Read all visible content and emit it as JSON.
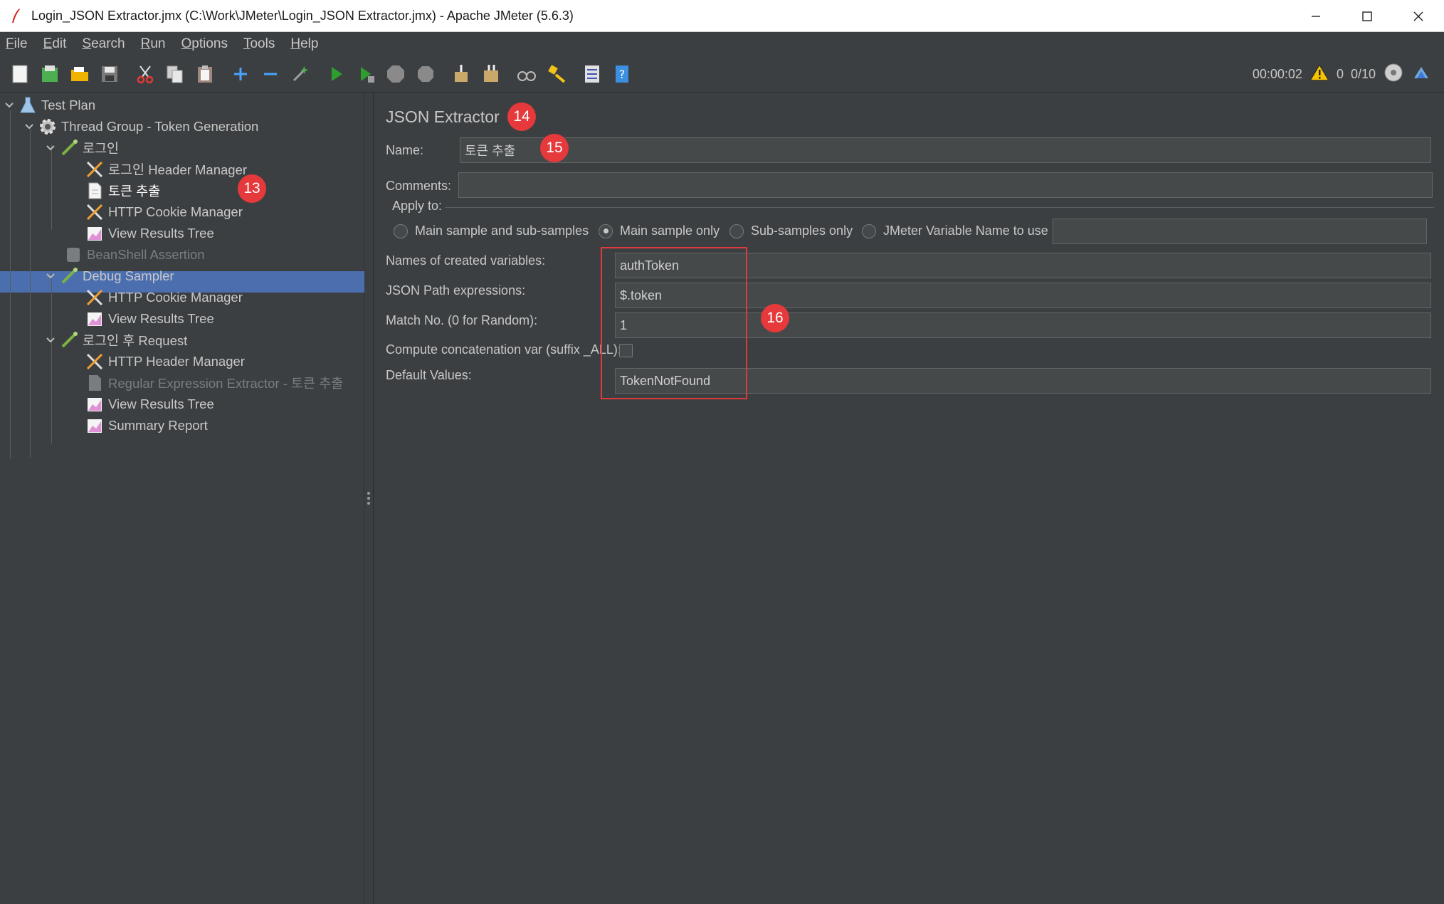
{
  "window": {
    "title": "Login_JSON Extractor.jmx (C:\\Work\\JMeter\\Login_JSON Extractor.jmx) - Apache JMeter (5.6.3)"
  },
  "menu": [
    {
      "mn": "F",
      "rest": "ile"
    },
    {
      "mn": "E",
      "rest": "dit"
    },
    {
      "mn": "S",
      "rest": "earch"
    },
    {
      "mn": "R",
      "rest": "un"
    },
    {
      "mn": "O",
      "rest": "ptions"
    },
    {
      "mn": "T",
      "rest": "ools"
    },
    {
      "mn": "H",
      "rest": "elp"
    }
  ],
  "status": {
    "elapsed": "00:00:02",
    "warnings": "0",
    "threads": "0/10"
  },
  "tree": {
    "test_plan": "Test Plan",
    "thread_group": "Thread Group - Token Generation",
    "login": "로그인",
    "login_header_manager": "로그인 Header Manager",
    "token_extract": "토큰 추출",
    "cookie_manager_1": "HTTP Cookie Manager",
    "results_tree_1": "View Results Tree",
    "beanshell": "BeanShell Assertion",
    "debug_sampler": "Debug Sampler",
    "cookie_manager_2": "HTTP Cookie Manager",
    "results_tree_2": "View Results Tree",
    "after_login": "로그인 후 Request",
    "header_manager": "HTTP Header Manager",
    "regex_extractor": "Regular Expression Extractor - 토큰 추출",
    "results_tree_3": "View Results Tree",
    "summary_report": "Summary Report"
  },
  "panel": {
    "title": "JSON Extractor",
    "name_label": "Name:",
    "name_value": "토큰 추출",
    "comments_label": "Comments:",
    "comments_value": "",
    "apply_to_label": "Apply to:",
    "apply_options": {
      "main_and_sub": "Main sample and sub-samples",
      "main_only": "Main sample only",
      "sub_only": "Sub-samples only",
      "jmeter_var": "JMeter Variable Name to use"
    },
    "apply_selected": "Main sample only",
    "jmeter_var_value": "",
    "var_names_label": "Names of created variables:",
    "var_names_value": "authToken",
    "json_path_label": "JSON Path expressions:",
    "json_path_value": "$.token",
    "match_no_label": "Match No. (0 for Random):",
    "match_no_value": "1",
    "concat_label": "Compute concatenation var (suffix _ALL):",
    "concat_checked": false,
    "default_label": "Default Values:",
    "default_value": "TokenNotFound"
  },
  "annotations": {
    "b13": "13",
    "b14": "14",
    "b15": "15",
    "b16": "16"
  },
  "colors": {
    "background": "#3c3f41",
    "selection": "#4b6eaf",
    "annotation_red": "#e5393b"
  }
}
